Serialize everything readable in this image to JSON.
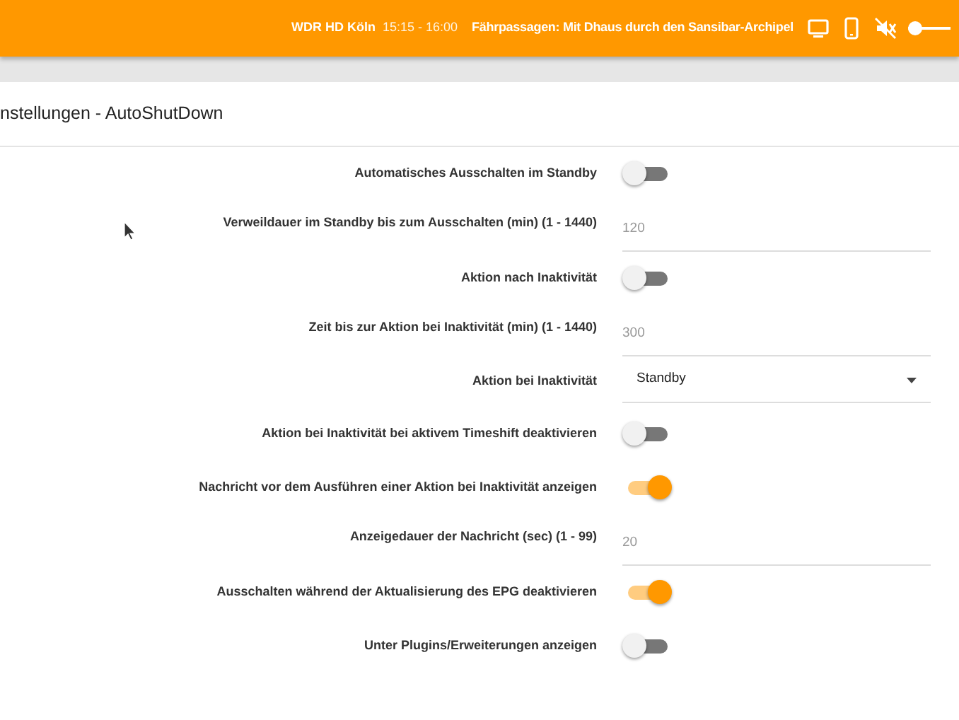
{
  "header": {
    "channel": "WDR HD Köln",
    "time": "15:15 - 16:00",
    "program": "Fährpassagen: Mit Dhaus durch den Sansibar-Archipel",
    "volume": {
      "muted": true,
      "level": 0
    }
  },
  "panel": {
    "title": "nstellungen - AutoShutDown"
  },
  "settings": [
    {
      "kind": "toggle",
      "label": "Automatisches Ausschalten im Standby",
      "on": false
    },
    {
      "kind": "field",
      "label": "Verweildauer im Standby bis zum Ausschalten (min) (1 - 1440)",
      "value": "120"
    },
    {
      "kind": "toggle",
      "label": "Aktion nach Inaktivität",
      "on": false
    },
    {
      "kind": "field",
      "label": "Zeit bis zur Aktion bei Inaktivität (min) (1 - 1440)",
      "value": "300"
    },
    {
      "kind": "select",
      "label": "Aktion bei Inaktivität",
      "value": "Standby"
    },
    {
      "kind": "toggle",
      "label": "Aktion bei Inaktivität bei aktivem Timeshift deaktivieren",
      "on": false
    },
    {
      "kind": "toggle",
      "label": "Nachricht vor dem Ausführen einer Aktion bei Inaktivität anzeigen",
      "on": true
    },
    {
      "kind": "field",
      "label": "Anzeigedauer der Nachricht (sec) (1 - 99)",
      "value": "20"
    },
    {
      "kind": "toggle",
      "label": "Ausschalten während der Aktualisierung des EPG deaktivieren",
      "on": true
    },
    {
      "kind": "toggle",
      "label": "Unter Plugins/Erweiterungen anzeigen",
      "on": false
    }
  ]
}
